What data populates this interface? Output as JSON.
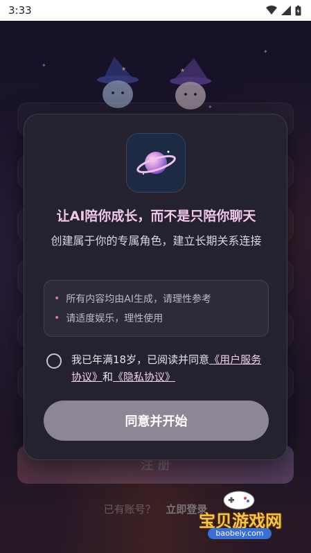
{
  "status_bar": {
    "time": "3:33"
  },
  "background": {
    "register_label": "注 册",
    "login_prompt": "已有账号？",
    "login_link": "立即登录"
  },
  "modal": {
    "title": "让AI陪你成长，而不是只陪你聊天",
    "subtitle": "创建属于你的专属角色，建立长期关系连接",
    "notices": [
      "所有内容均由AI生成，请理性参考",
      "请适度娱乐，理性使用"
    ],
    "agree_prefix": "我已年满18岁，已阅读并同意",
    "user_agreement": "《用户服务协议》",
    "and": "和",
    "privacy_policy": "《隐私协议》",
    "start_button": "同意并开始"
  },
  "watermark": {
    "name": "宝贝游戏网",
    "url": "baobeiy.com"
  },
  "colors": {
    "title": "#f2c7e9",
    "accent_dot": "#e17a98",
    "button": "#8e8595",
    "modal_bg": "#24222f"
  }
}
